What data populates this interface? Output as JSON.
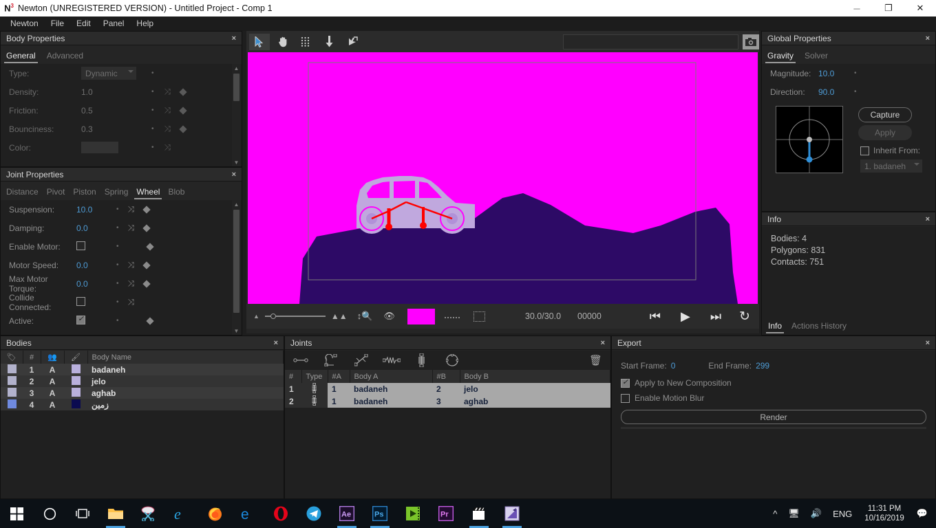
{
  "window": {
    "title": "Newton (UNREGISTERED VERSION) - Untitled Project - Comp 1",
    "logo": "N",
    "logo_sup": "3",
    "minimize": "minimize-icon",
    "maximize": "restore-icon",
    "close": "close-icon"
  },
  "menu": {
    "items": [
      "Newton",
      "File",
      "Edit",
      "Panel",
      "Help"
    ]
  },
  "body_properties": {
    "title": "Body Properties",
    "close": "×",
    "tabs": [
      {
        "label": "General",
        "active": true
      },
      {
        "label": "Advanced",
        "active": false
      }
    ],
    "fields": [
      {
        "label": "Type:",
        "value": "Dynamic",
        "kind": "select",
        "dot": "·",
        "shuffle": false,
        "diamond": false
      },
      {
        "label": "Density:",
        "value": "1.0",
        "kind": "number",
        "dot": "·",
        "shuffle": true,
        "diamond": true
      },
      {
        "label": "Friction:",
        "value": "0.5",
        "kind": "number",
        "dot": "·",
        "shuffle": true,
        "diamond": true
      },
      {
        "label": "Bounciness:",
        "value": "0.3",
        "kind": "number",
        "dot": "·",
        "shuffle": true,
        "diamond": true
      },
      {
        "label": "Color:",
        "value": "",
        "kind": "swatch",
        "dot": "·",
        "shuffle": true,
        "diamond": false
      }
    ]
  },
  "joint_properties": {
    "title": "Joint Properties",
    "close": "×",
    "tabs": [
      {
        "label": "Distance",
        "active": false
      },
      {
        "label": "Pivot",
        "active": false
      },
      {
        "label": "Piston",
        "active": false
      },
      {
        "label": "Spring",
        "active": false
      },
      {
        "label": "Wheel",
        "active": true
      },
      {
        "label": "Blob",
        "active": false
      }
    ],
    "fields": [
      {
        "label": "Suspension:",
        "value": "10.0",
        "kind": "number",
        "dot": "·",
        "shuffle": true,
        "diamond": true
      },
      {
        "label": "Damping:",
        "value": "0.0",
        "kind": "number",
        "dot": "·",
        "shuffle": true,
        "diamond": true
      },
      {
        "label": "Enable Motor:",
        "value": "",
        "kind": "checkbox",
        "checked": false,
        "dot": "·",
        "shuffle": false,
        "diamond": true
      },
      {
        "label": "Motor Speed:",
        "value": "0.0",
        "kind": "number",
        "dot": "·",
        "shuffle": true,
        "diamond": true
      },
      {
        "label": "Max Motor Torque:",
        "value": "0.0",
        "kind": "number",
        "dot": "·",
        "shuffle": true,
        "diamond": true
      },
      {
        "label": "Collide Connected:",
        "value": "",
        "kind": "checkbox",
        "checked": false,
        "dot": "·",
        "shuffle": true,
        "diamond": false
      },
      {
        "label": "Active:",
        "value": "",
        "kind": "checkbox",
        "checked": true,
        "dot": "·",
        "shuffle": false,
        "diamond": true
      }
    ]
  },
  "viewport": {
    "tools": [
      {
        "name": "select-arrow-tool",
        "active": true
      },
      {
        "name": "pan-hand-tool",
        "active": false
      },
      {
        "name": "grid-tool",
        "active": false
      },
      {
        "name": "gravity-arrow-tool",
        "active": false
      },
      {
        "name": "launch-tool",
        "active": false
      }
    ],
    "search_value": "",
    "search_placeholder": "",
    "camera_icon": "camera-icon",
    "playback": {
      "zoom_slider_value": 0,
      "fps": "30.0/30.0",
      "frame": "00000",
      "color_swatch": "#ff00ff",
      "buttons": [
        {
          "name": "go-to-start-button",
          "glyph": "⏮"
        },
        {
          "name": "play-button",
          "glyph": "▶"
        },
        {
          "name": "step-forward-button",
          "glyph": "⏭"
        },
        {
          "name": "loop-button",
          "glyph": "↻"
        }
      ]
    },
    "scene": {
      "background": "#ff00ff",
      "ground_color": "#2d0a66",
      "car_body_color": "#b9a0d8",
      "joint_color": "#ff0000",
      "comp_border": "#6b6b6b"
    }
  },
  "global_properties": {
    "title": "Global Properties",
    "close": "×",
    "tabs": [
      {
        "label": "Gravity",
        "active": true
      },
      {
        "label": "Solver",
        "active": false
      }
    ],
    "magnitude_label": "Magnitude:",
    "magnitude_value": "10.0",
    "direction_label": "Direction:",
    "direction_value": "90.0",
    "capture_button": "Capture",
    "apply_button": "Apply",
    "inherit_label": "Inherit From:",
    "inherit_checked": false,
    "inherit_value": "1. badaneh"
  },
  "info_panel": {
    "title": "Info",
    "close": "×",
    "lines": [
      "Bodies: 4",
      "Polygons: 831",
      "Contacts: 751"
    ],
    "tabs": [
      {
        "label": "Info",
        "active": true
      },
      {
        "label": "Actions History",
        "active": false
      }
    ]
  },
  "bodies_panel": {
    "title": "Bodies",
    "close": "×",
    "headers": [
      "tag-icon",
      "#",
      "group-icon",
      "brush-icon",
      "Body Name"
    ],
    "header_name": "Body Name",
    "header_num": "#",
    "rows": [
      {
        "num": "1",
        "group": "A",
        "name": "badaneh",
        "tag_color": "#b2b2cc",
        "brush_color": "#b9b0dd"
      },
      {
        "num": "2",
        "group": "A",
        "name": "jelo",
        "tag_color": "#b2b2cc",
        "brush_color": "#b9b0dd"
      },
      {
        "num": "3",
        "group": "A",
        "name": "aghab",
        "tag_color": "#b2b2cc",
        "brush_color": "#b9b0dd"
      },
      {
        "num": "4",
        "group": "A",
        "name": "زمین",
        "tag_color": "#6f8ae0",
        "brush_color": "#0b0b50"
      }
    ]
  },
  "joints_panel": {
    "title": "Joints",
    "close": "×",
    "tools": [
      {
        "name": "distance-joint-tool"
      },
      {
        "name": "pivot-joint-tool"
      },
      {
        "name": "piston-joint-tool"
      },
      {
        "name": "spring-joint-tool"
      },
      {
        "name": "wheel-joint-tool"
      },
      {
        "name": "blob-joint-tool"
      }
    ],
    "delete_icon": "trash-icon",
    "headers": [
      "#",
      "Type",
      "#A",
      "Body A",
      "#B",
      "Body B"
    ],
    "rows": [
      {
        "num": "1",
        "type": "wheel-joint-icon",
        "a_num": "1",
        "a_name": "badaneh",
        "b_num": "2",
        "b_name": "jelo"
      },
      {
        "num": "2",
        "type": "wheel-joint-icon",
        "a_num": "1",
        "a_name": "badaneh",
        "b_num": "3",
        "b_name": "aghab"
      }
    ]
  },
  "export_panel": {
    "title": "Export",
    "close": "×",
    "start_frame_label": "Start Frame:",
    "start_frame_value": "0",
    "end_frame_label": "End Frame:",
    "end_frame_value": "299",
    "apply_comp_label": "Apply to New Composition",
    "apply_comp_checked": true,
    "motion_blur_label": "Enable Motion Blur",
    "motion_blur_checked": false,
    "render_button": "Render"
  },
  "taskbar": {
    "items": [
      {
        "name": "start-button",
        "icon": "windows-logo-icon",
        "running": false
      },
      {
        "name": "cortana-search",
        "icon": "circle-icon",
        "running": false
      },
      {
        "name": "task-view",
        "icon": "task-view-icon",
        "running": false
      },
      {
        "name": "file-explorer",
        "icon": "folder-icon",
        "running": true
      },
      {
        "name": "snipping-tool",
        "icon": "scissors-icon",
        "running": false
      },
      {
        "name": "internet-explorer",
        "icon": "ie-icon",
        "running": false
      },
      {
        "name": "firefox",
        "icon": "firefox-icon",
        "running": true
      },
      {
        "name": "edge",
        "icon": "edge-icon",
        "running": false
      },
      {
        "name": "opera",
        "icon": "opera-icon",
        "running": false
      },
      {
        "name": "telegram",
        "icon": "telegram-icon",
        "running": false
      },
      {
        "name": "after-effects",
        "icon": "ae-icon",
        "running": true
      },
      {
        "name": "photoshop",
        "icon": "ps-icon",
        "running": true
      },
      {
        "name": "media-encoder",
        "icon": "me-icon",
        "running": false
      },
      {
        "name": "premiere-pro",
        "icon": "pr-icon",
        "running": false
      },
      {
        "name": "movie-app",
        "icon": "clapperboard-icon",
        "running": true
      },
      {
        "name": "newton-app",
        "icon": "newton-icon",
        "running": true
      }
    ],
    "tray": {
      "chevron": "show-hidden-icons",
      "network": "network-icon",
      "volume": "volume-icon",
      "language": "ENG",
      "time": "11:31 PM",
      "date": "10/16/2019",
      "action_center": "action-center-icon"
    }
  }
}
